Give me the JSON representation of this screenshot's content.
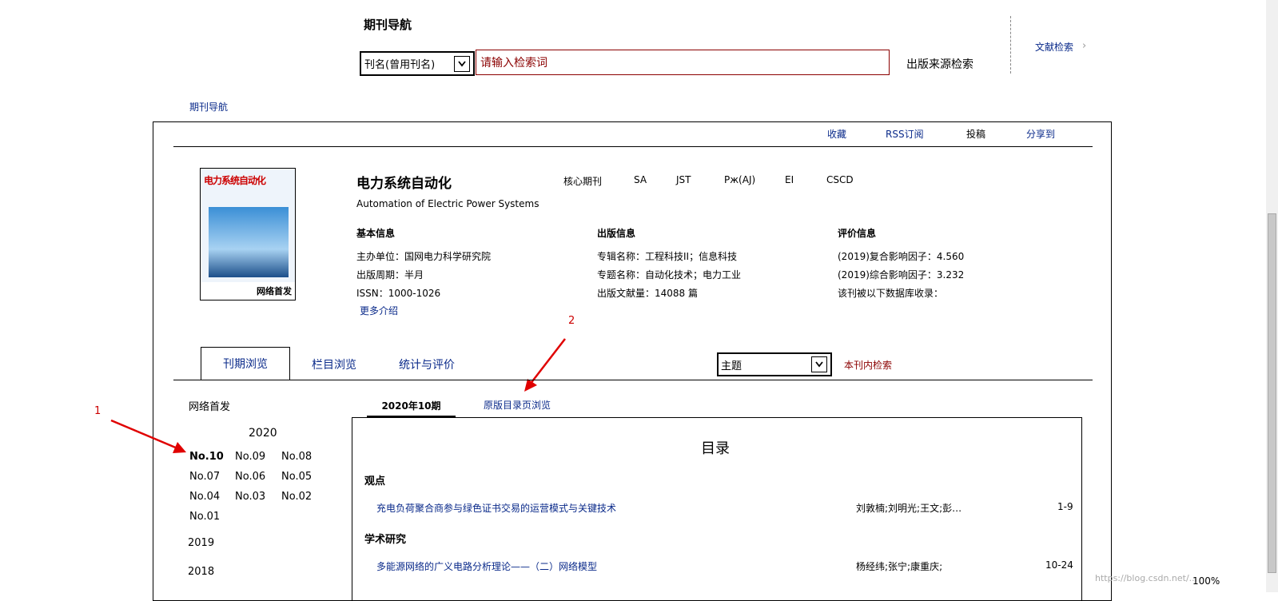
{
  "top": {
    "title": "期刊导航",
    "search_type": "刊名(曾用刊名)",
    "search_placeholder": "请输入检索词",
    "search_source": "出版来源检索",
    "doc_search": "文献检索",
    "doc_search_chevron": "›"
  },
  "breadcrumb": "期刊导航",
  "toolbar": [
    "收藏",
    "RSS订阅",
    "投稿",
    "分享到"
  ],
  "journal": {
    "cover_title": "电力系统自动化",
    "cover_badge": "网络首发",
    "title": "电力系统自动化",
    "subtitle": "Automation of Electric Power Systems",
    "tags": [
      "核心期刊",
      "SA",
      "JST",
      "Pж(AJ)",
      "EI",
      "CSCD"
    ],
    "more": "更多介绍"
  },
  "sections": {
    "basic": {
      "title": "基本信息",
      "lines": [
        "主办单位：国网电力科学研究院",
        "出版周期：半月",
        "ISSN：1000-1026"
      ]
    },
    "publish": {
      "title": "出版信息",
      "lines": [
        "专辑名称：工程科技II；信息科技",
        "专题名称：自动化技术；电力工业",
        "出版文献量：14088 篇"
      ]
    },
    "evaluate": {
      "title": "评价信息",
      "lines": [
        "(2019)复合影响因子：4.560",
        "(2019)综合影响因子：3.232",
        "该刊被以下数据库收录："
      ]
    }
  },
  "annotations": {
    "one": "1",
    "two": "2"
  },
  "tabs": [
    "刊期浏览",
    "栏目浏览",
    "统计与评价"
  ],
  "filter": {
    "selected": "主题",
    "search": "本刊内检索"
  },
  "left_panel": {
    "title": "网络首发",
    "year_current": "2020",
    "issues": [
      "No.10",
      "No.09",
      "No.08",
      "No.07",
      "No.06",
      "No.05",
      "No.04",
      "No.03",
      "No.02",
      "No.01"
    ],
    "years": [
      "2019",
      "2018"
    ]
  },
  "issue_tabs": {
    "current": "2020年10期",
    "original": "原版目录页浏览"
  },
  "toc": {
    "title": "目录",
    "sections": [
      {
        "name": "观点",
        "articles": [
          {
            "title": "充电负荷聚合商参与绿色证书交易的运营模式与关键技术",
            "authors": "刘敦楠;刘明光;王文;彭…",
            "pages": "1-9"
          }
        ]
      },
      {
        "name": "学术研究",
        "articles": [
          {
            "title": "多能源网络的广义电路分析理论——（二）网络模型",
            "authors": "杨经纬;张宁;康重庆;",
            "pages": "10-24"
          }
        ]
      }
    ]
  },
  "status": {
    "zoom": "100%",
    "watermark": "https://blog.csdn.net/..."
  }
}
